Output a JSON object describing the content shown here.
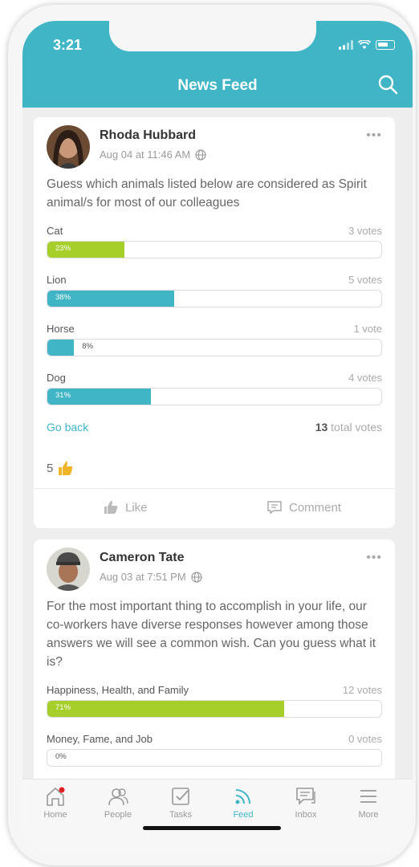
{
  "status": {
    "time": "3:21"
  },
  "header": {
    "title": "News Feed"
  },
  "posts": [
    {
      "author": "Rhoda Hubbard",
      "date": "Aug 04 at 11:46 AM",
      "text": "Guess which animals listed below are considered as Spirit animal/s for most of our colleagues",
      "options": [
        {
          "label": "Cat",
          "votes": "3 votes",
          "percent": "23%",
          "value": 0.23,
          "color": "#a6cf2b"
        },
        {
          "label": "Lion",
          "votes": "5 votes",
          "percent": "38%",
          "value": 0.38,
          "color": "#3fb5c5"
        },
        {
          "label": "Horse",
          "votes": "1 vote",
          "percent": "8%",
          "value": 0.08,
          "color": "#3fb5c5"
        },
        {
          "label": "Dog",
          "votes": "4 votes",
          "percent": "31%",
          "value": 0.31,
          "color": "#3fb5c5"
        }
      ],
      "go_back": "Go back",
      "total_count": "13",
      "total_label": "total votes",
      "reactions": "5",
      "like_label": "Like",
      "comment_label": "Comment"
    },
    {
      "author": "Cameron Tate",
      "date": "Aug 03 at 7:51 PM",
      "text": "For the most important thing to accomplish in your life, our co-workers have diverse responses however among those answers we will see a common wish. Can you guess what it is?",
      "options": [
        {
          "label": "Happiness, Health, and Family",
          "votes": "12 votes",
          "percent": "71%",
          "value": 0.71,
          "color": "#a6cf2b"
        },
        {
          "label": "Money, Fame, and Job",
          "votes": "0 votes",
          "percent": "0%",
          "value": 0.0,
          "color": "#3fb5c5"
        }
      ]
    }
  ],
  "tabbar": {
    "items": [
      {
        "label": "Home"
      },
      {
        "label": "People"
      },
      {
        "label": "Tasks"
      },
      {
        "label": "Feed"
      },
      {
        "label": "Inbox"
      },
      {
        "label": "More"
      }
    ],
    "active": "Feed"
  },
  "colors": {
    "accent": "#3fb5c5",
    "green": "#a6cf2b",
    "notification": "#e02020"
  }
}
